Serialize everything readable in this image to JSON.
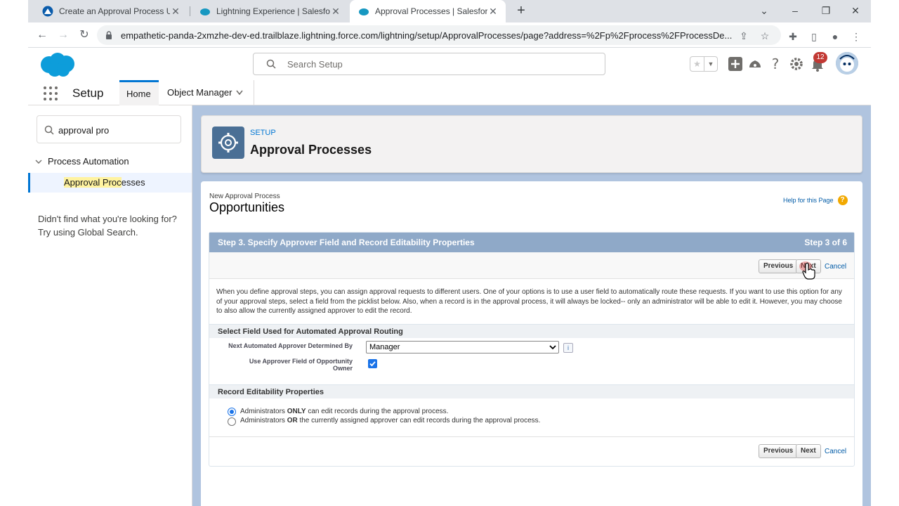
{
  "browser": {
    "tabs": [
      {
        "title": "Create an Approval Process Unit",
        "active": false
      },
      {
        "title": "Lightning Experience | Salesforce",
        "active": false
      },
      {
        "title": "Approval Processes | Salesforce",
        "active": true
      }
    ],
    "url": "empathetic-panda-2xmzhe-dev-ed.trailblaze.lightning.force.com/lightning/setup/ApprovalProcesses/page?address=%2Fp%2Fprocess%2FProcessDe..."
  },
  "header": {
    "search_placeholder": "Search Setup",
    "notification_count": "12"
  },
  "context_nav": {
    "app_name": "Setup",
    "tabs": [
      {
        "label": "Home",
        "active": true
      },
      {
        "label": "Object Manager",
        "active": false
      }
    ]
  },
  "sidebar": {
    "quick_find_value": "approval pro",
    "tree_header": "Process Automation",
    "item_highlight": "Approval Proc",
    "item_rest": "esses",
    "not_found_line1": "Didn't find what you're looking for?",
    "not_found_line2": "Try using Global Search."
  },
  "page_header": {
    "eyebrow": "SETUP",
    "title": "Approval Processes"
  },
  "content": {
    "subhead": "New Approval Process",
    "title": "Opportunities",
    "help_link": "Help for this Page",
    "step_title": "Step 3. Specify Approver Field and Record Editability Properties",
    "step_count": "Step 3 of 6",
    "buttons": {
      "previous": "Previous",
      "next": "Next",
      "cancel": "Cancel"
    },
    "description": "When you define approval steps, you can assign approval requests to different users. One of your options is to use a user field to automatically route these requests. If you want to use this option for any of your approval steps, select a field from the picklist below. Also, when a record is in the approval process, it will always be locked-- only an administrator will be able to edit it. However, you may choose to also allow the currently assigned approver to edit the record.",
    "section1": "Select Field Used for Automated Approval Routing",
    "next_approver_label": "Next Automated Approver Determined By",
    "next_approver_value": "Manager",
    "use_owner_label_1": "Use Approver Field of Opportunity",
    "use_owner_label_2": "Owner",
    "use_owner_checked": true,
    "section2": "Record Editability Properties",
    "radio1_a": "Administrators ",
    "radio1_b": "ONLY",
    "radio1_c": " can edit records during the approval process.",
    "radio2_a": "Administrators ",
    "radio2_b": "OR",
    "radio2_c": " the currently assigned approver can edit records during the approval process.",
    "radio_selected": 1
  },
  "colors": {
    "accent": "#0176d3",
    "step_header": "#8fa9c8",
    "main_background": "#b0c4df",
    "notification_badge": "#c23934"
  }
}
